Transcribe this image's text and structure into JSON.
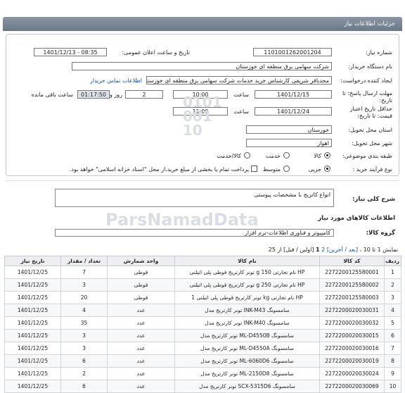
{
  "header": {
    "title": "جزئیات اطلاعات نیاز"
  },
  "form": {
    "need_number_label": "شماره نیاز:",
    "need_number": "1101001262001204",
    "announce_label": "تاریخ و ساعت اعلان عمومی:",
    "announce_value": "1401/12/13 - 08:35",
    "buyer_label": "نام دستگاه خریدار:",
    "buyer_value": "شرکت سهامی برق منطقه ای خوزستان",
    "creator_label": "ایجاد کننده درخواست:",
    "creator_value": "مجدباقر شریفی کارشناس خرید خدمات شرکت سهامی برق منطقه ای خوزستان",
    "contact_link": "اطلاعات تماس خریدار",
    "deadline_label": "مهلت ارسال پاسخ: تا تاریخ:",
    "deadline_date": "1401/12/15",
    "time_label": "ساعت",
    "deadline_time": "10:00",
    "days_value": "2",
    "days_label": "روز و",
    "remaining_value": "01:17:50",
    "remaining_label": "ساعت باقی مانده",
    "validity_label": "حداقل تاریخ اعتبار قیمت: تا تاریخ:",
    "validity_date": "1401/12/24",
    "validity_time_label": "ساعت",
    "validity_time": "11:00",
    "province_label": "استان محل تحویل:",
    "province_value": "خوزستان",
    "city_label": "شهر محل تحویل:",
    "city_value": "اهواز",
    "category_label": "طبقه بندی موضوعی:",
    "category_options": [
      "کالا",
      "خدمت",
      "کالا/خدمت"
    ],
    "category_selected": "کالا",
    "process_label": "نوع فرآیند خرید :",
    "process_options": [
      "جزیی",
      "متوسط"
    ],
    "process_selected": "جزیی",
    "payment_note": "پرداخت تمام یا بخشی از مبلغ خرید،از محل \"اسناد خزانه اسلامی\" خواهد بود."
  },
  "description": {
    "label": "شرح کلی نیاز:",
    "value": "انواع کاتریج با مشخصات پیوستی"
  },
  "goods_title": "اطلاعات کالاهای مورد نیاز",
  "group": {
    "label": "گروه کالا:",
    "value": "کامپیوتر و فناوری اطلاعات-نرم افزار"
  },
  "pagination": {
    "text_prefix": "نمایش 1 تا 10 ،",
    "first": "[اولین / قبل]",
    "current": "1",
    "page2": "2",
    "next_last": "[بعد / آخرین]",
    "suffix": "از 25"
  },
  "table": {
    "headers": [
      "ردیف",
      "کد کالا",
      "نام کالا",
      "واحد شمارش",
      "تعداد / مقدار",
      "تاریخ نیاز"
    ],
    "rows": [
      [
        "1",
        "2272200125580001",
        "تونر کارتریج قوطی پلی اتیلنی g 150 نام تجارتی HP",
        "قوطی",
        "7",
        "1401/12/25"
      ],
      [
        "2",
        "2272200125580002",
        "تونر کارتریج قوطی پلی اتیلنی g 250 نام تجارتی HP",
        "قوطی",
        "3",
        "1401/12/25"
      ],
      [
        "3",
        "2272200125580003",
        "تونر کارتریج قوطی پلی اتیلنی 1 kg نام تجارتی HP",
        "قوطی",
        "20",
        "1401/12/25"
      ],
      [
        "4",
        "2272200020030031",
        "تونر کارتریج مدل INK-M43 سامسونگ",
        "عدد",
        "4",
        "1401/12/25"
      ],
      [
        "5",
        "2272200020030032",
        "تونر کارتریج مدل INK-M40 سامسونگ",
        "عدد",
        "35",
        "1401/12/25"
      ],
      [
        "6",
        "2272200020030015",
        "تونر کارتریج مدل ML-D4550B سامسونگ",
        "عدد",
        "3",
        "1401/12/25"
      ],
      [
        "7",
        "2272200020030016",
        "تونر کارتریج مدل ML-D4550A سامسونگ",
        "عدد",
        "3",
        "1401/12/25"
      ],
      [
        "8",
        "2272200020030019",
        "تونر کارتریج مدل ML-6060D6 سامسونگ",
        "عدد",
        "6",
        "1401/12/25"
      ],
      [
        "9",
        "2272200020030024",
        "تونر کارتریج مدل ML-2150D8 سامسونگ",
        "عدد",
        "2",
        "1401/12/25"
      ],
      [
        "10",
        "2272200020030069",
        "تونر کارتریج مدل SCX-5315D6 سامسونگ",
        "عدد",
        "6",
        "1401/12/25"
      ]
    ]
  },
  "watermark": {
    "brand": "ParsNamadData"
  }
}
